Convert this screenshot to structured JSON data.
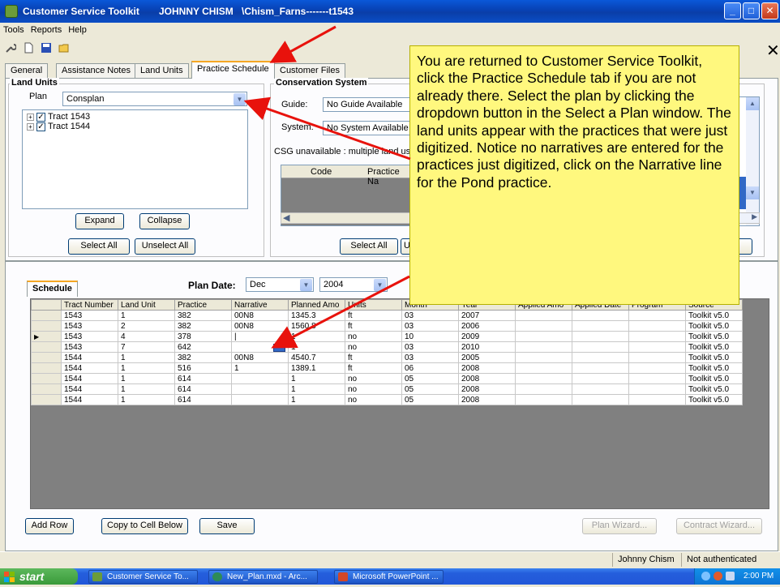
{
  "window": {
    "app_title": "Customer Service Toolkit",
    "user": "JOHNNY CHISM",
    "path": "\\Chism_Farns-------t1543",
    "minimize": "_",
    "maximize": "□",
    "close": "✕"
  },
  "menu": [
    "Tools",
    "Reports",
    "Help"
  ],
  "toolbar_close": "✕",
  "tabs": [
    "General",
    "Assistance Notes",
    "Land Units",
    "Practice Schedule",
    "Customer Files"
  ],
  "land_units": {
    "title": "Land Units",
    "plan_label": "Plan",
    "plan_value": "Consplan",
    "tree": [
      {
        "label": "Tract 1543"
      },
      {
        "label": "Tract 1544"
      }
    ],
    "expand": "Expand",
    "collapse": "Collapse",
    "select_all": "Select All",
    "unselect_all": "Unselect All"
  },
  "conservation_system": {
    "title": "Conservation System",
    "guide_label": "Guide:",
    "guide_value": "No Guide Available",
    "system_label": "System:",
    "system_value": "No System Available",
    "csg_note": "CSG unavailable : multiple land use",
    "col_code": "Code",
    "col_practice": "Practice Na",
    "select_all": "Select All",
    "unselect_partial": "U"
  },
  "callout": "You are returned to Customer Service Toolkit, click the Practice Schedule tab if you are not already there. Select the plan by clicking the dropdown button in the Select a Plan window. The land units appear with the practices that were just digitized. Notice no narratives are entered for the practices just digitized, click on the Narrative line for the Pond practice.",
  "schedule": {
    "tab_label": "Schedule",
    "plan_date_label": "Plan Date:",
    "month": "Dec",
    "year": "2004",
    "columns": [
      "Tract Number",
      "Land Unit",
      "Practice",
      "Narrative",
      "Planned Amo",
      "Units",
      "Month",
      "Year",
      "Applied Amo",
      "Applied Date",
      "Program",
      "Source"
    ],
    "rows": [
      [
        "1543",
        "1",
        "382",
        "00N8",
        "1345.3",
        "ft",
        "03",
        "2007",
        "",
        "",
        "",
        "Toolkit v5.0"
      ],
      [
        "1543",
        "2",
        "382",
        "00N8",
        "1560.8",
        "ft",
        "03",
        "2006",
        "",
        "",
        "",
        "Toolkit v5.0"
      ],
      [
        "1543",
        "4",
        "378",
        "|",
        "1",
        "no",
        "10",
        "2009",
        "",
        "",
        "",
        "Toolkit v5.0"
      ],
      [
        "1543",
        "7",
        "642",
        "",
        "1",
        "no",
        "03",
        "2010",
        "",
        "",
        "",
        "Toolkit v5.0"
      ],
      [
        "1544",
        "1",
        "382",
        "00N8",
        "4540.7",
        "ft",
        "03",
        "2005",
        "",
        "",
        "",
        "Toolkit v5.0"
      ],
      [
        "1544",
        "1",
        "516",
        "1",
        "1389.1",
        "ft",
        "06",
        "2008",
        "",
        "",
        "",
        "Toolkit v5.0"
      ],
      [
        "1544",
        "1",
        "614",
        "",
        "1",
        "no",
        "05",
        "2008",
        "",
        "",
        "",
        "Toolkit v5.0"
      ],
      [
        "1544",
        "1",
        "614",
        "",
        "1",
        "no",
        "05",
        "2008",
        "",
        "",
        "",
        "Toolkit v5.0"
      ],
      [
        "1544",
        "1",
        "614",
        "",
        "1",
        "no",
        "05",
        "2008",
        "",
        "",
        "",
        "Toolkit v5.0"
      ]
    ],
    "current_row_marker": "▶",
    "add_row": "Add Row",
    "copy_to_cell_below": "Copy to Cell Below",
    "save": "Save",
    "plan_wizard": "Plan Wizard...",
    "contract_wizard": "Contract Wizard..."
  },
  "status": {
    "user": "Johnny Chism",
    "auth": "Not authenticated"
  },
  "taskbar": {
    "start": "start",
    "tasks": [
      "Customer Service To...",
      "New_Plan.mxd - Arc...",
      "Microsoft PowerPoint ..."
    ],
    "clock": "2:00 PM"
  },
  "colors": {
    "titlebar": "#0841b3",
    "callout_bg": "#fff87e",
    "arrow": "#e8120c"
  }
}
